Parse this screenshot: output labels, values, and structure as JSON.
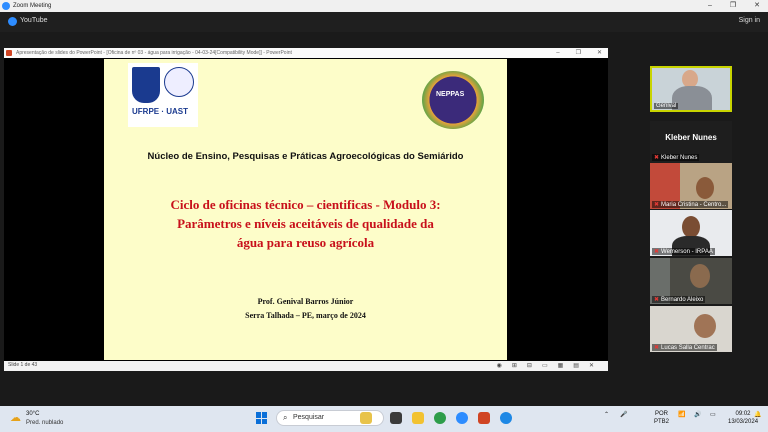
{
  "zoom": {
    "title": "Zoom Meeting",
    "window_controls": [
      "–",
      "❐",
      "✕"
    ],
    "tab": "YouTube",
    "signin": "Sign in"
  },
  "ppt": {
    "title": "Apresentação de slides do PowerPoint - [Oficina de nº 03 - água para irrigação - 04-03-24[Compatibility Mode]] - PowerPoint",
    "window_controls": [
      "–",
      "❐",
      "✕"
    ],
    "slide_counter": "Slide 1 de 43",
    "controls": [
      "◉",
      "⊞",
      "⊟",
      "▭",
      "▦",
      "▤",
      "✕"
    ]
  },
  "slide": {
    "logo_ufrpe": "UFRPE · UAST",
    "logo_neppas": "NEPPAS",
    "nucleo": "Núcleo de Ensino, Pesquisas e Práticas Agroecológicas do Semiárido",
    "ciclo_lines": [
      "Ciclo de oficinas técnico – cientificas - Modulo 3:",
      "Parâmetros e níveis aceitáveis de qualidade da",
      "água para reuso agrícola"
    ],
    "prof": "Prof. Genival Barros Júnior",
    "place": "Serra Talhada – PE, março de 2024"
  },
  "participants": [
    {
      "name": "Genival"
    },
    {
      "name": "Kleber Nunes",
      "big": "Kleber Nunes"
    },
    {
      "name": "Maria Cristina - Centro..."
    },
    {
      "name": "Wemerson - IRPAA"
    },
    {
      "name": "Bernardo Aleixo"
    },
    {
      "name": "Lucas Salla Centrac"
    }
  ],
  "taskbar": {
    "weather_temp": "30°C",
    "weather_desc": "Pred. nublado",
    "search_placeholder": "Pesquisar",
    "lang_top": "POR",
    "lang_bottom": "PTB2",
    "time": "09:02",
    "date": "13/03/2024"
  }
}
